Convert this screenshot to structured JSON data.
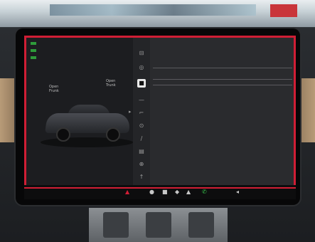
{
  "car_panel": {
    "labels": [
      {
        "text": "Open\nFrunk"
      },
      {
        "text": "Open\nTrunk"
      }
    ],
    "bottom_text": "",
    "arrow_icon": "chevron-right-icon"
  },
  "menu": {
    "items": [
      {
        "icon": "car-icon",
        "glyph": "⊟",
        "active": false
      },
      {
        "icon": "lightbulb-icon",
        "glyph": "◎",
        "active": false
      },
      {
        "icon": "lock-icon",
        "glyph": "■",
        "active": true
      },
      {
        "icon": "display-icon",
        "glyph": "—",
        "active": false
      },
      {
        "icon": "steering-icon",
        "glyph": "⌐",
        "active": false
      },
      {
        "icon": "autopilot-icon",
        "glyph": "⊙",
        "active": false
      },
      {
        "icon": "trips-icon",
        "glyph": "∕",
        "active": false
      },
      {
        "icon": "navigation-icon",
        "glyph": "▤",
        "active": false
      },
      {
        "icon": "safety-icon",
        "glyph": "⊕",
        "active": false
      },
      {
        "icon": "service-icon",
        "glyph": "↑",
        "active": false
      },
      {
        "icon": "software-icon",
        "glyph": "↓",
        "active": false
      }
    ]
  },
  "content": {
    "title": "",
    "rows": [],
    "top_right": ""
  },
  "taskbar": {
    "caption": "",
    "items": [
      {
        "name": "car-icon",
        "glyph": "▲",
        "style": "red"
      },
      {
        "name": "app-1-icon",
        "glyph": "●",
        "style": ""
      },
      {
        "name": "app-2-icon",
        "glyph": "■",
        "style": ""
      },
      {
        "name": "app-3-icon",
        "glyph": "◆",
        "style": ""
      },
      {
        "name": "app-4-icon",
        "glyph": "▲",
        "style": ""
      },
      {
        "name": "phone-icon",
        "glyph": "✆",
        "style": "green"
      },
      {
        "name": "volume-icon",
        "glyph": "◂",
        "style": ""
      }
    ]
  },
  "colors": {
    "accent_red": "#d01e35",
    "check_green": "#3fbf4f"
  }
}
